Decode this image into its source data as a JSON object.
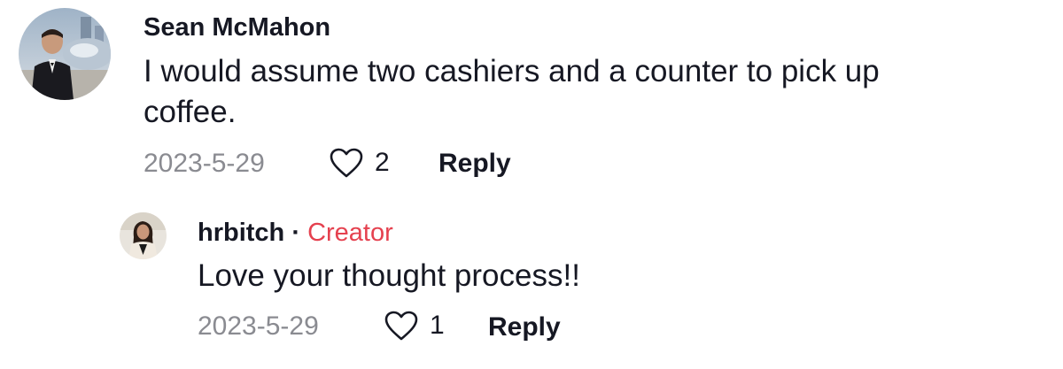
{
  "comments": [
    {
      "username": "Sean McMahon",
      "text": "I would assume two cashiers and a counter to pick up coffee.",
      "date": "2023-5-29",
      "likes": "2",
      "reply_label": "Reply",
      "avatar_icon": "profile-photo-avatar"
    },
    {
      "username": "hrbitch",
      "separator": "·",
      "badge": "Creator",
      "text": "Love your thought process!!",
      "date": "2023-5-29",
      "likes": "1",
      "reply_label": "Reply",
      "avatar_icon": "profile-photo-avatar"
    }
  ],
  "colors": {
    "text": "#161823",
    "muted": "#8a8b91",
    "creator": "#e5414f"
  }
}
